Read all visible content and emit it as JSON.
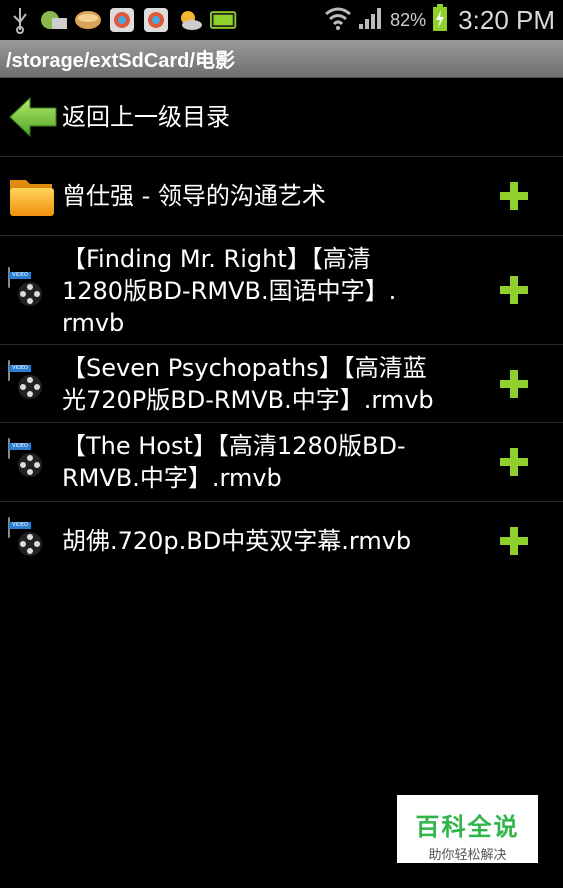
{
  "status_bar": {
    "battery_pct": "82%",
    "time": "3:20 PM"
  },
  "path_bar": {
    "path": "/storage/extSdCard/电影"
  },
  "list": {
    "back_label": "返回上一级目录",
    "items": [
      {
        "type": "folder",
        "line1": "曾仕强 - 领导的沟通艺术",
        "line2": "",
        "line3": ""
      },
      {
        "type": "video",
        "line1": "【Finding Mr. Right】【高清",
        "line2": "1280版BD-RMVB.国语中字】.",
        "line3": "rmvb"
      },
      {
        "type": "video",
        "line1": "【Seven Psychopaths】【高清蓝",
        "line2": "光720P版BD-RMVB.中字】.rmvb",
        "line3": ""
      },
      {
        "type": "video",
        "line1": "【The Host】【高清1280版BD-",
        "line2": "RMVB.中字】.rmvb",
        "line3": ""
      },
      {
        "type": "video",
        "line1": "胡佛.720p.BD中英双字幕.rmvb",
        "line2": "",
        "line3": ""
      }
    ]
  },
  "watermark": {
    "title": "百科全说",
    "subtitle": "助你轻松解决"
  },
  "colors": {
    "accent_green": "#8fd12a",
    "path_bar": "#808080"
  }
}
